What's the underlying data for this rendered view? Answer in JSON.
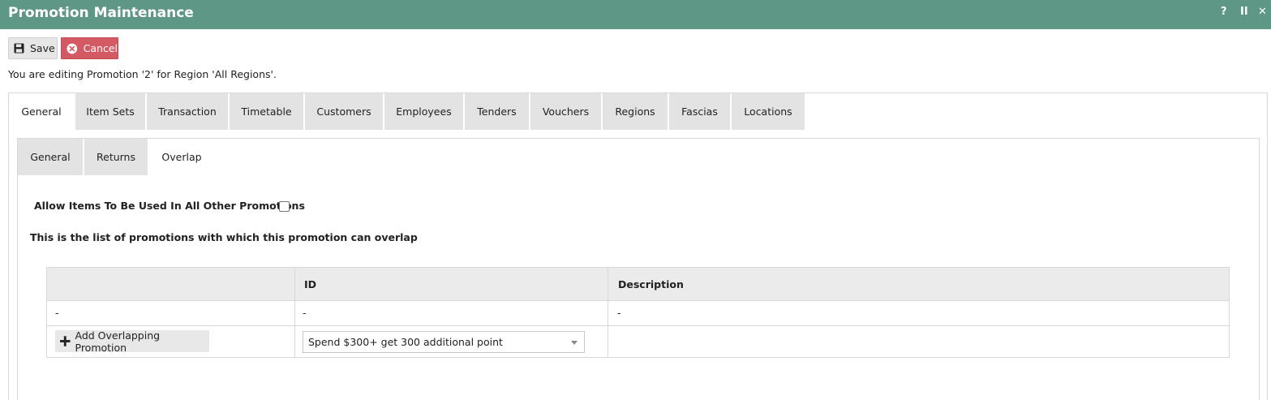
{
  "window": {
    "title": "Promotion Maintenance",
    "help_label": "?",
    "pause_label": "II",
    "close_label": "✕"
  },
  "toolbar": {
    "save_label": "Save",
    "cancel_label": "Cancel"
  },
  "editing_message": "You are editing Promotion '2' for Region 'All Regions'.",
  "tabs": [
    {
      "label": "General",
      "active": true
    },
    {
      "label": "Item Sets"
    },
    {
      "label": "Transaction"
    },
    {
      "label": "Timetable"
    },
    {
      "label": "Customers"
    },
    {
      "label": "Employees"
    },
    {
      "label": "Tenders"
    },
    {
      "label": "Vouchers"
    },
    {
      "label": "Regions"
    },
    {
      "label": "Fascias"
    },
    {
      "label": "Locations"
    }
  ],
  "subtabs": [
    {
      "label": "General"
    },
    {
      "label": "Returns"
    },
    {
      "label": "Overlap",
      "active": true
    }
  ],
  "overlap": {
    "allow_label": "Allow Items To Be Used In All Other Promotions",
    "allow_checked": false,
    "list_message": "This is the list of promotions with which this promotion can overlap"
  },
  "grid": {
    "columns": [
      "",
      "ID",
      "Description"
    ],
    "rows": [
      [
        "-",
        "-",
        "-"
      ]
    ],
    "add_button_label": "Add Overlapping Promotion",
    "selected_promotion": "Spend $300+ get 300 additional point"
  },
  "colors": {
    "titlebar": "#5f9787",
    "cancel": "#d35963"
  }
}
